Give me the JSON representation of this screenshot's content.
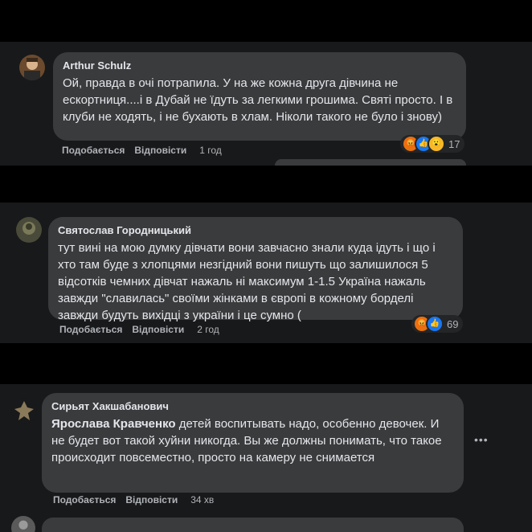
{
  "comments": [
    {
      "author": "Arthur Schulz",
      "text": "Ой, правда в очі потрапила. У на же кожна друга дівчина не ескортниця....і в Дубай не їдуть за легкими грошима. Святі просто. І в клуби не ходять, і не бухають в хлам. Ніколи такого не було і знову)",
      "like": "Подобається",
      "reply": "Відповісти",
      "time": "1 год",
      "reaction_count": "17",
      "reactions": [
        "angry",
        "like",
        "wow"
      ]
    },
    {
      "author": "Святослав Городницький",
      "text": "тут вині на мою думку дівчати вони завчасно знали куда ідуть і що і хто там буде з хлопцями незгідний вони пишуть що залишилося 5 відсотків чемних дівчат нажаль ні максимум 1-1.5 Україна нажаль завжди \"славилась\" своїми жінками в європі в кожному борделі завжди будуть вихідці з україни і це сумно (",
      "like": "Подобається",
      "reply": "Відповісти",
      "time": "2 год",
      "reaction_count": "69",
      "reactions": [
        "angry",
        "like"
      ]
    },
    {
      "author": "Сирьят Хакшабанович",
      "mention": "Ярослава Кравченко",
      "text": " детей воспитывать надо, особенно девочек. И не будет вот такой хуйни никогда. Вы же должны понимать, что такое происходит повсеместно, просто на камеру не снимается",
      "like": "Подобається",
      "reply": "Відповісти",
      "time": "34 хв",
      "more": "•••"
    }
  ],
  "colors": {
    "background": "#000000",
    "panel": "#18191a",
    "bubble": "#3a3b3c",
    "text": "#e4e6eb",
    "secondary_text": "#b0b3b8"
  }
}
